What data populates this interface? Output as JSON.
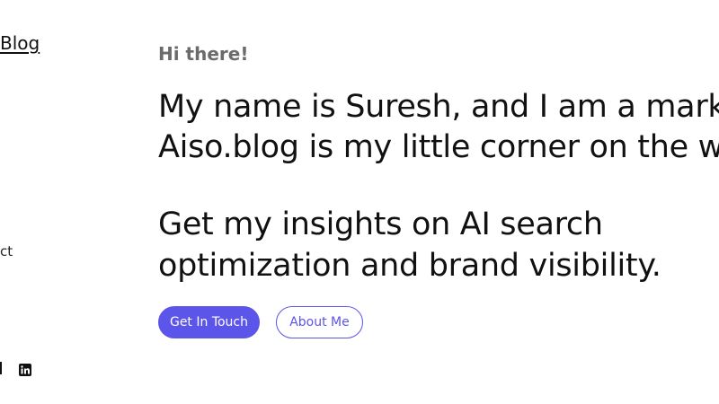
{
  "sidebar": {
    "blog_partial_prefix": "",
    "blog_label": "Blog",
    "contact_partial": "ct"
  },
  "main": {
    "greeting": "Hi there!",
    "intro_line_1": "My name is Suresh, and I am a market",
    "intro_line_2": "Aiso.blog is my little corner on the we",
    "tagline_line_1": "Get my insights on AI search",
    "tagline_line_2": "optimization and brand visibility.",
    "primary_button": "Get In Touch",
    "secondary_button": "About Me"
  },
  "icons": {
    "social": "linkedin-icon"
  },
  "colors": {
    "accent": "#5b55ea",
    "greeting": "#6b6b6b",
    "text": "#111111",
    "background": "#ffffff"
  }
}
